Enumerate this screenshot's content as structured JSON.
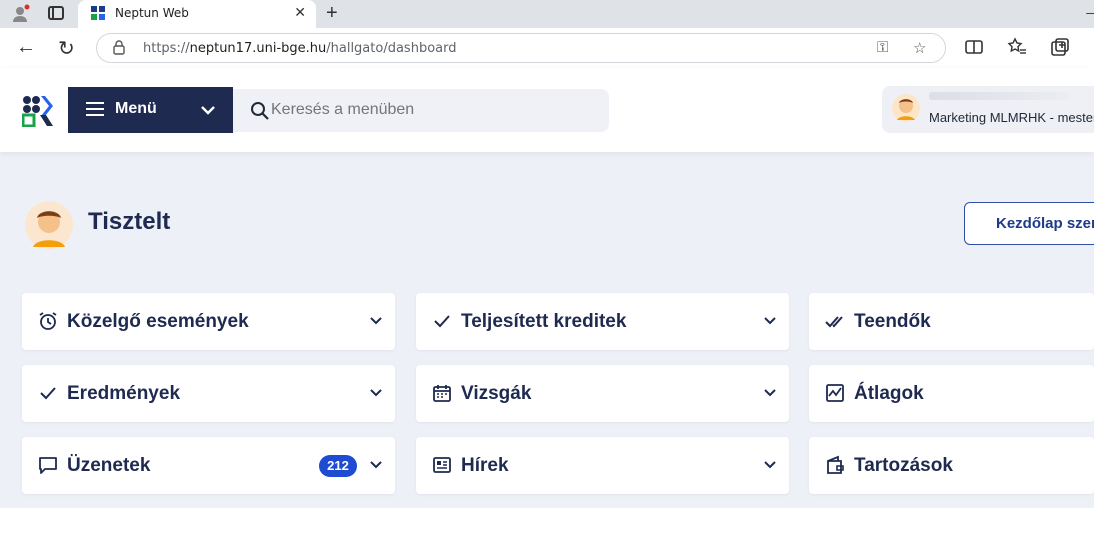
{
  "browser": {
    "tab_title": "Neptun Web",
    "url_prefix": "https://",
    "url_host": "neptun17.uni-bge.hu",
    "url_path": "/hallgato/dashboard"
  },
  "header": {
    "menu_label": "Menü",
    "search_placeholder": "Keresés a menüben",
    "user_role": "Marketing MLMRHK - mester"
  },
  "greeting": "Tisztelt",
  "edit_button": "Kezdőlap szerk",
  "cards": {
    "upcoming_events": "Közelgő események",
    "completed_credits": "Teljesített kreditek",
    "todos": "Teendők",
    "results": "Eredmények",
    "exams": "Vizsgák",
    "averages": "Átlagok",
    "messages": "Üzenetek",
    "messages_badge": "212",
    "news": "Hírek",
    "debts": "Tartozások"
  },
  "colors": {
    "navy": "#1e2a4f",
    "badge_blue": "#1e4bd2",
    "page_bg": "#eef0f8"
  }
}
